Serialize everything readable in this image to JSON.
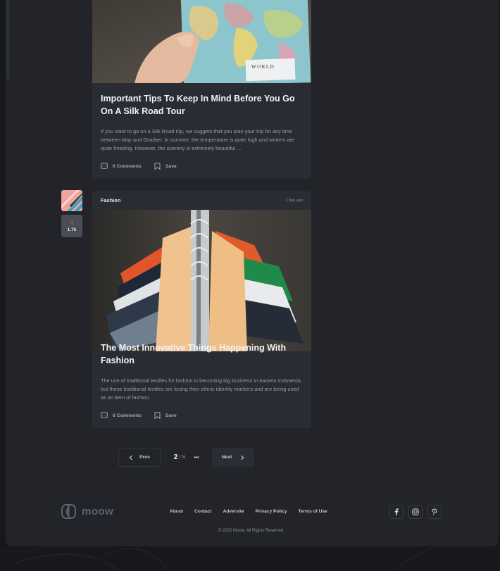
{
  "posts": [
    {
      "title": "Important Tips To Keep In Mind Before You Go On A Silk Road Tour",
      "excerpt": "If you want to go on a Silk Road trip, we suggest that you plan your trip for any time between May and October. In summer, the temperature is quite high and winters are quite freezing. However, the scenery is extremely beautiful ...",
      "comments_label": "6 Comments",
      "save_label": "Save",
      "image_icon": "map-in-hand-photo",
      "map_label": "WORLD"
    },
    {
      "category": "Fashion",
      "time_ago": "2 day ago",
      "title": "The Most Innovative Things Happening With Fashion",
      "excerpt": "The use of traditional textiles for fashion is becoming big business in eastern Indonesia, but these traditional textiles are losing their ethnic identity markers and are being used as an item of fashion.",
      "comments_label": "6 Comments",
      "save_label": "Save",
      "image_icon": "clothes-rack-photo",
      "votes": "1.7k"
    }
  ],
  "pagination": {
    "prev_label": "Prev",
    "next_label": "Next",
    "current_page": "2",
    "total_pages": "/ 76",
    "ellipsis": "•••"
  },
  "footer": {
    "logo_text": "moow",
    "links": [
      "About",
      "Contact",
      "Adversite",
      "Privacy Policy",
      "Terms of Use"
    ],
    "social_icons": [
      "facebook-icon",
      "instagram-icon",
      "pinterest-icon"
    ],
    "copyright": "© 2020 Moow. All Rights Reserved."
  },
  "colors": {
    "background": "#17181c",
    "panel": "#22242a",
    "card": "#2a2c33",
    "accent": "#f5b23a"
  }
}
